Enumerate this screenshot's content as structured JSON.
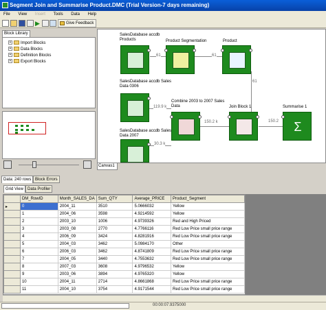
{
  "window": {
    "title": "Segment Join and Summarise Product.DMC (Trial Version-7 days remaining)"
  },
  "menu": [
    "File",
    "View",
    "Insert",
    "Tools",
    "Data",
    "Help"
  ],
  "toolbar": {
    "feedback_label": "Give Feedback"
  },
  "block_library": {
    "tab": "Block Library",
    "items": [
      "Import Blocks",
      "Data Blocks",
      "Definition Blocks",
      "Export Blocks"
    ]
  },
  "canvas": {
    "tab": "Canvas1",
    "nodes": [
      {
        "label": "SalesDatabase accdb\nProducts",
        "icon": "import-db-icon"
      },
      {
        "label": "Product Segmentation",
        "icon": "segmentation-icon"
      },
      {
        "label": "Product",
        "icon": "book-icon"
      },
      {
        "label": "SalesDatabase accdb Sales\nData 0306",
        "icon": "import-db-icon"
      },
      {
        "label": "Combine 2003 to 2007 Sales\nData",
        "icon": "combine-icon"
      },
      {
        "label": "Join Block 1",
        "icon": "join-icon"
      },
      {
        "label": "Summarise 1",
        "icon": "sigma-icon"
      },
      {
        "label": "SalesDatabase accdb Sales\nData 2007",
        "icon": "import-db-icon"
      }
    ],
    "edges": [
      "61",
      "61",
      "61",
      "119.9 k",
      "150.2 k",
      "150.2",
      "30.3 k"
    ]
  },
  "bottom": {
    "data_tab": "Data: 240 rows",
    "errors_tab": "Block Errors",
    "grid_tab": "Grid View",
    "profiler_tab": "Data Profiler"
  },
  "table": {
    "columns": [
      "DM_RowID",
      "Month_SALES_DA",
      "Sum_QTY",
      "Average_PRICE",
      "Product_Segment"
    ],
    "rows": [
      [
        "0",
        "2004_11",
        "3510",
        "5.0666032",
        "Yellow"
      ],
      [
        "1",
        "2004_06",
        "3598",
        "4.9214592",
        "Yellow"
      ],
      [
        "2",
        "2003_10",
        "1006",
        "4.9739326",
        "Red and High Priced"
      ],
      [
        "3",
        "2003_08",
        "2770",
        "4.7766116",
        "Red Low Price small price range"
      ],
      [
        "4",
        "2006_09",
        "3424",
        "4.8281916",
        "Red Low Price small price range"
      ],
      [
        "5",
        "2004_03",
        "3462",
        "5.0984170",
        "Other"
      ],
      [
        "6",
        "2006_03",
        "3462",
        "4.8741809",
        "Red Low Price small price range"
      ],
      [
        "7",
        "2004_05",
        "3440",
        "4.7553632",
        "Red Low Price small price range"
      ],
      [
        "8",
        "2007_03",
        "3608",
        "4.9796532",
        "Yellow"
      ],
      [
        "9",
        "2003_06",
        "3894",
        "4.9765320",
        "Yellow"
      ],
      [
        "10",
        "2004_11",
        "2714",
        "4.8661868",
        "Red Low Price small price range"
      ],
      [
        "11",
        "2004_10",
        "3754",
        "4.9171544",
        "Red Low Price small price range"
      ]
    ]
  },
  "status": {
    "time": "00:00:07.9375000"
  }
}
